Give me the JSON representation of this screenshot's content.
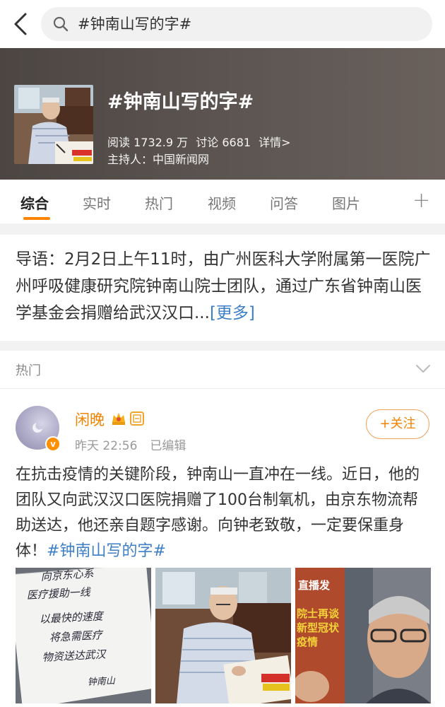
{
  "search": {
    "query": "#钟南山写的字#"
  },
  "topic": {
    "title": "#钟南山写的字#",
    "reads": "阅读 1732.9 万",
    "discussions": "讨论 6681",
    "details_link": "详情>",
    "host": "主持人：中国新闻网"
  },
  "tabs": [
    "综合",
    "实时",
    "热门",
    "视频",
    "问答",
    "图片"
  ],
  "intro": {
    "text": "导语：2月2日上午11时，由广州医科大学附属第一医院广州呼吸健康研究院钟南山院士团队，通过广东省钟南山医学基金会捐赠给武汉汉口...",
    "more": "[更多]"
  },
  "hot_section": {
    "label": "热门"
  },
  "post": {
    "username": "闲晚",
    "time": "昨天 22:56",
    "edited": "已编辑",
    "follow_label": "+关注",
    "body": "在抗击疫情的关键阶段，钟南山一直冲在一线。近日，他的团队又向武汉汉口医院捐赠了100台制氧机，由京东物流帮助送达，他还亲自题字感谢。向钟老致敬，一定要保重身体！",
    "hashtag": "#钟南山写的字#",
    "photo_texts": {
      "calligraphy": [
        "向京东心系",
        "医疗援助一线",
        "以最快的速度",
        "将急需医疗",
        "物资送达武汉",
        "钟南山"
      ],
      "news": [
        "直播发",
        "院士再谈",
        "新型冠状",
        "疫情"
      ]
    }
  },
  "colors": {
    "accent": "#ff8200",
    "link": "#3d7fc7",
    "username": "#f08300"
  }
}
